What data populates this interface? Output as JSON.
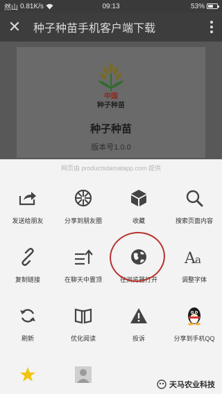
{
  "status_bar": {
    "carrier": "然山",
    "speed": "0.81K/s",
    "time": "09:13",
    "battery": "53%"
  },
  "title_bar": {
    "title": "种子种苗手机客户端下载"
  },
  "app_info": {
    "logo_text_top": "中国",
    "logo_text_bottom": "种子种苗",
    "name": "种子种苗",
    "version": "版本号1.0.0"
  },
  "share_sheet": {
    "provider": "网页由 productsdamatapp.com 提供",
    "rows": [
      [
        {
          "label": "发送给朋友",
          "icon": "share-forward-icon"
        },
        {
          "label": "分享到朋友圈",
          "icon": "moments-icon"
        },
        {
          "label": "收藏",
          "icon": "favorite-cube-icon"
        },
        {
          "label": "搜索页面内容",
          "icon": "search-icon"
        }
      ],
      [
        {
          "label": "复制链接",
          "icon": "link-icon"
        },
        {
          "label": "在聊天中置顶",
          "icon": "pin-to-top-icon"
        },
        {
          "label": "在浏览器打开",
          "icon": "globe-icon"
        },
        {
          "label": "调整字体",
          "icon": "font-size-icon"
        }
      ],
      [
        {
          "label": "刷新",
          "icon": "refresh-icon"
        },
        {
          "label": "优化阅读",
          "icon": "reading-book-icon"
        },
        {
          "label": "投诉",
          "icon": "warning-icon"
        },
        {
          "label": "分享到手机QQ",
          "icon": "qq-penguin-icon"
        }
      ]
    ]
  },
  "watermark": {
    "text": "天马农业科技"
  }
}
